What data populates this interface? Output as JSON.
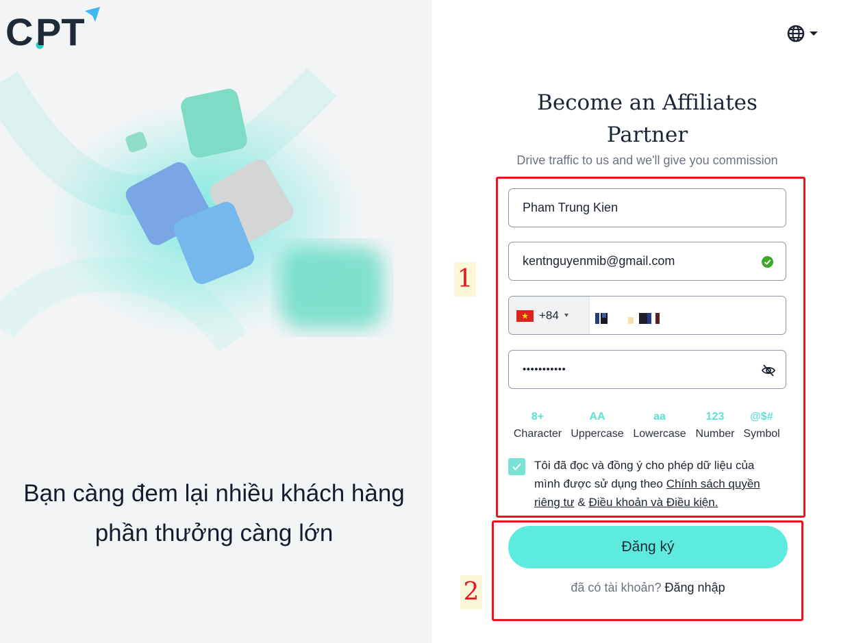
{
  "brand": {
    "logo_text": "CPT"
  },
  "left_panel": {
    "slogan": "Bạn càng đem lại nhiều khách hàng phần thưởng càng lớn"
  },
  "header": {
    "language_icon": "globe-icon",
    "language_caret": "caret-down-icon"
  },
  "form": {
    "title": "Become an Affiliates Partner",
    "subtitle": "Drive traffic to us and we'll give you commission",
    "name_value": "Pham Trung Kien",
    "email_value": "kentnguyenmib@gmail.com",
    "email_status_icon": "check-circle-icon",
    "phone": {
      "country_flag": "flag-vn-icon",
      "dial_code": "+84"
    },
    "password_mask": "•••••••••••",
    "password_toggle_icon": "eye-slash-icon",
    "requirements": [
      {
        "symbol": "8+",
        "label": "Character"
      },
      {
        "symbol": "AA",
        "label": "Uppercase"
      },
      {
        "symbol": "aa",
        "label": "Lowercase"
      },
      {
        "symbol": "123",
        "label": "Number"
      },
      {
        "symbol": "@$#",
        "label": "Symbol"
      }
    ],
    "agree": {
      "checked": true,
      "text_before": "Tôi đã đọc và đồng ý cho phép dữ liệu của mình được sử dụng theo ",
      "privacy_link": "Chính sách quyền riêng tư",
      "joiner": " & ",
      "terms_link": "Điều khoản và Điều kiện."
    },
    "submit_label": "Đăng ký",
    "login_prompt": "đã có tài khoản? ",
    "login_link": "Đăng nhập"
  },
  "annotations": {
    "marker_1": "1",
    "marker_2": "2"
  },
  "colors": {
    "accent": "#5debdf",
    "annotation": "#e8141a",
    "success": "#3fa72a"
  }
}
